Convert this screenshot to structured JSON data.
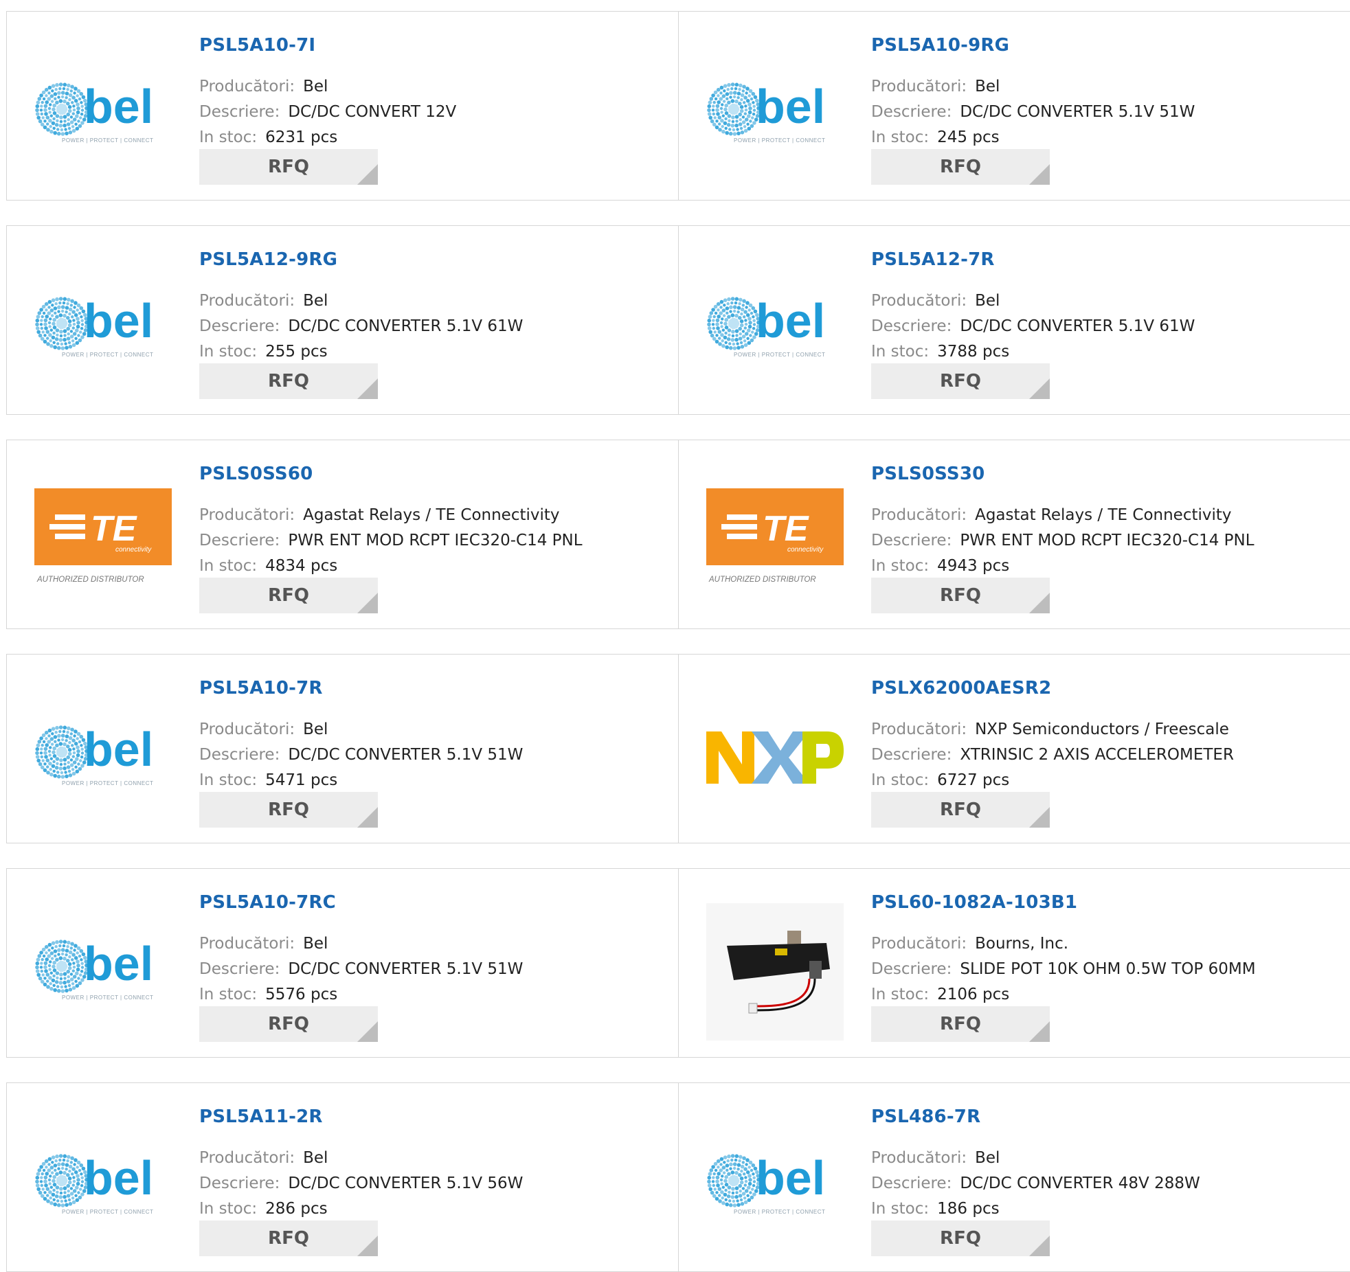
{
  "labels": {
    "manufacturer": "Producători:",
    "description": "Descriere:",
    "stock": "In stoc:",
    "rfq": "RFQ"
  },
  "logo_text": {
    "bel": {
      "wordmark": "bel",
      "tagline": "POWER | PROTECT | CONNECT"
    },
    "te": {
      "wordmark": "TE",
      "sub": "connectivity",
      "tagline": "AUTHORIZED DISTRIBUTOR"
    },
    "nxp": {
      "wordmark": "NXP"
    }
  },
  "colors": {
    "link": "#1a66b0",
    "bel_blue": "#1f9bd7",
    "te_orange": "#f28c28",
    "nxp_yellow": "#f9b500",
    "nxp_blue": "#7bb1db",
    "nxp_green": "#c9d200"
  },
  "products": [
    {
      "part": "PSL5A10-7I",
      "manufacturer": "Bel",
      "description": "DC/DC CONVERT 12V",
      "stock": "6231 pcs",
      "logo": "bel"
    },
    {
      "part": "PSL5A10-9RG",
      "manufacturer": "Bel",
      "description": "DC/DC CONVERTER 5.1V 51W",
      "stock": "245 pcs",
      "logo": "bel"
    },
    {
      "part": "PSL5A12-9RG",
      "manufacturer": "Bel",
      "description": "DC/DC CONVERTER 5.1V 61W",
      "stock": "255 pcs",
      "logo": "bel"
    },
    {
      "part": "PSL5A12-7R",
      "manufacturer": "Bel",
      "description": "DC/DC CONVERTER 5.1V 61W",
      "stock": "3788 pcs",
      "logo": "bel"
    },
    {
      "part": "PSLS0SS60",
      "manufacturer": "Agastat Relays / TE Connectivity",
      "description": "PWR ENT MOD RCPT IEC320-C14 PNL",
      "stock": "4834 pcs",
      "logo": "te"
    },
    {
      "part": "PSLS0SS30",
      "manufacturer": "Agastat Relays / TE Connectivity",
      "description": "PWR ENT MOD RCPT IEC320-C14 PNL",
      "stock": "4943 pcs",
      "logo": "te"
    },
    {
      "part": "PSL5A10-7R",
      "manufacturer": "Bel",
      "description": "DC/DC CONVERTER 5.1V 51W",
      "stock": "5471 pcs",
      "logo": "bel"
    },
    {
      "part": "PSLX62000AESR2",
      "manufacturer": "NXP Semiconductors / Freescale",
      "description": "XTRINSIC 2 AXIS ACCELEROMETER",
      "stock": "6727 pcs",
      "logo": "nxp"
    },
    {
      "part": "PSL5A10-7RC",
      "manufacturer": "Bel",
      "description": "DC/DC CONVERTER 5.1V 51W",
      "stock": "5576 pcs",
      "logo": "bel"
    },
    {
      "part": "PSL60-1082A-103B1",
      "manufacturer": "Bourns, Inc.",
      "description": "SLIDE POT 10K OHM 0.5W TOP 60MM",
      "stock": "2106 pcs",
      "logo": "slidepot"
    },
    {
      "part": "PSL5A11-2R",
      "manufacturer": "Bel",
      "description": "DC/DC CONVERTER 5.1V 56W",
      "stock": "286 pcs",
      "logo": "bel"
    },
    {
      "part": "PSL486-7R",
      "manufacturer": "Bel",
      "description": "DC/DC CONVERTER 48V 288W",
      "stock": "186 pcs",
      "logo": "bel"
    }
  ]
}
